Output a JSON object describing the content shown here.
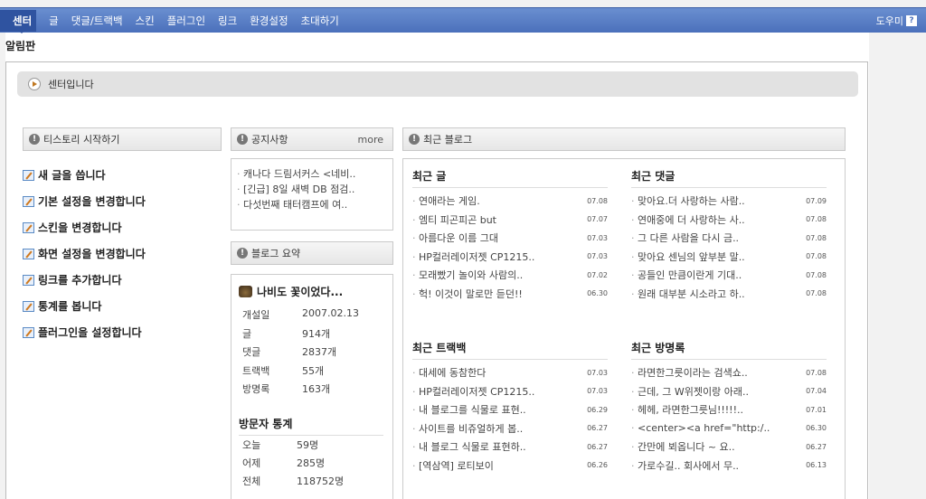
{
  "nav": {
    "items": [
      "센터",
      "글",
      "댓글/트랙백",
      "스킨",
      "플러그인",
      "링크",
      "환경설정",
      "초대하기"
    ],
    "help": "도우미",
    "help_icon": "?"
  },
  "page_title": "알림판",
  "welcome": "센터입니다",
  "start": {
    "title": "티스토리 시작하기",
    "items": [
      "새 글을 씁니다",
      "기본 설정을 변경합니다",
      "스킨을 변경합니다",
      "화면 설정을 변경합니다",
      "링크를 추가합니다",
      "통계를 봅니다",
      "플러그인을 설정합니다"
    ]
  },
  "notice": {
    "title": "공지사항",
    "more": "more",
    "items": [
      "캐나다 드림서커스 <네비..",
      "[긴급] 8일 새벽 DB 점검..",
      "다섯번째 태터캠프에 여.."
    ]
  },
  "summary": {
    "title": "블로그 요약",
    "blog_name": "나비도 꽃이었다...",
    "rows": [
      {
        "k": "개설일",
        "v": "2007.02.13"
      },
      {
        "k": "글",
        "v": "914개"
      },
      {
        "k": "댓글",
        "v": "2837개"
      },
      {
        "k": "트랙백",
        "v": "55개"
      },
      {
        "k": "방명록",
        "v": "163개"
      }
    ],
    "visit_title": "방문자 통계",
    "visits": [
      {
        "k": "오늘",
        "v": "59명"
      },
      {
        "k": "어제",
        "v": "285명"
      },
      {
        "k": "전체",
        "v": "118752명"
      }
    ]
  },
  "recent": {
    "title": "최근 블로그",
    "posts": {
      "title": "최근 글",
      "items": [
        {
          "t": "연애라는 게임.",
          "d": "07.08"
        },
        {
          "t": "엠티 피곤피곤 but",
          "d": "07.07"
        },
        {
          "t": "아름다운 이름 그대",
          "d": "07.03"
        },
        {
          "t": "HP컬러레이저젯 CP1215..",
          "d": "07.03"
        },
        {
          "t": "모래빴기 놀이와 사람의..",
          "d": "07.02"
        },
        {
          "t": "헉! 이것이 말로만 듣던!!",
          "d": "06.30"
        }
      ]
    },
    "comments": {
      "title": "최근 댓글",
      "items": [
        {
          "t": "맞아요.더 사랑하는 사람..",
          "d": "07.09"
        },
        {
          "t": "연애중에 더 사랑하는 사..",
          "d": "07.08"
        },
        {
          "t": "그 다른 사람을 다시 금..",
          "d": "07.08"
        },
        {
          "t": "맞아요 센님의 앞부분 말..",
          "d": "07.08"
        },
        {
          "t": "공들인 만큼이란게 기대..",
          "d": "07.08"
        },
        {
          "t": "원래 대부분 시소라고 하..",
          "d": "07.08"
        }
      ]
    },
    "trackbacks": {
      "title": "최근 트랙백",
      "items": [
        {
          "t": "대세에 동참한다",
          "d": "07.03"
        },
        {
          "t": "HP컬러레이저젯 CP1215..",
          "d": "07.03"
        },
        {
          "t": "내 블로그를 식물로 표현..",
          "d": "06.29"
        },
        {
          "t": "사이트를 비쥬얼하게 봅..",
          "d": "06.27"
        },
        {
          "t": "내 블로그 식물로 표현하..",
          "d": "06.27"
        },
        {
          "t": "[역삼역] 로티보이",
          "d": "06.26"
        }
      ]
    },
    "guestbook": {
      "title": "최근 방명록",
      "items": [
        {
          "t": "라면한그릇이라는 검색쇼..",
          "d": "07.08"
        },
        {
          "t": "근데, 그 W위젯이랑 아래..",
          "d": "07.04"
        },
        {
          "t": "헤헤, 라면한그릇님!!!!!..",
          "d": "07.01"
        },
        {
          "t": "<center><a href=\"http:/..",
          "d": "06.30"
        },
        {
          "t": "간만에 뵈옵니다 ~ 요..",
          "d": "06.27"
        },
        {
          "t": "가로수길.. 회사에서 무..",
          "d": "06.13"
        }
      ]
    }
  }
}
